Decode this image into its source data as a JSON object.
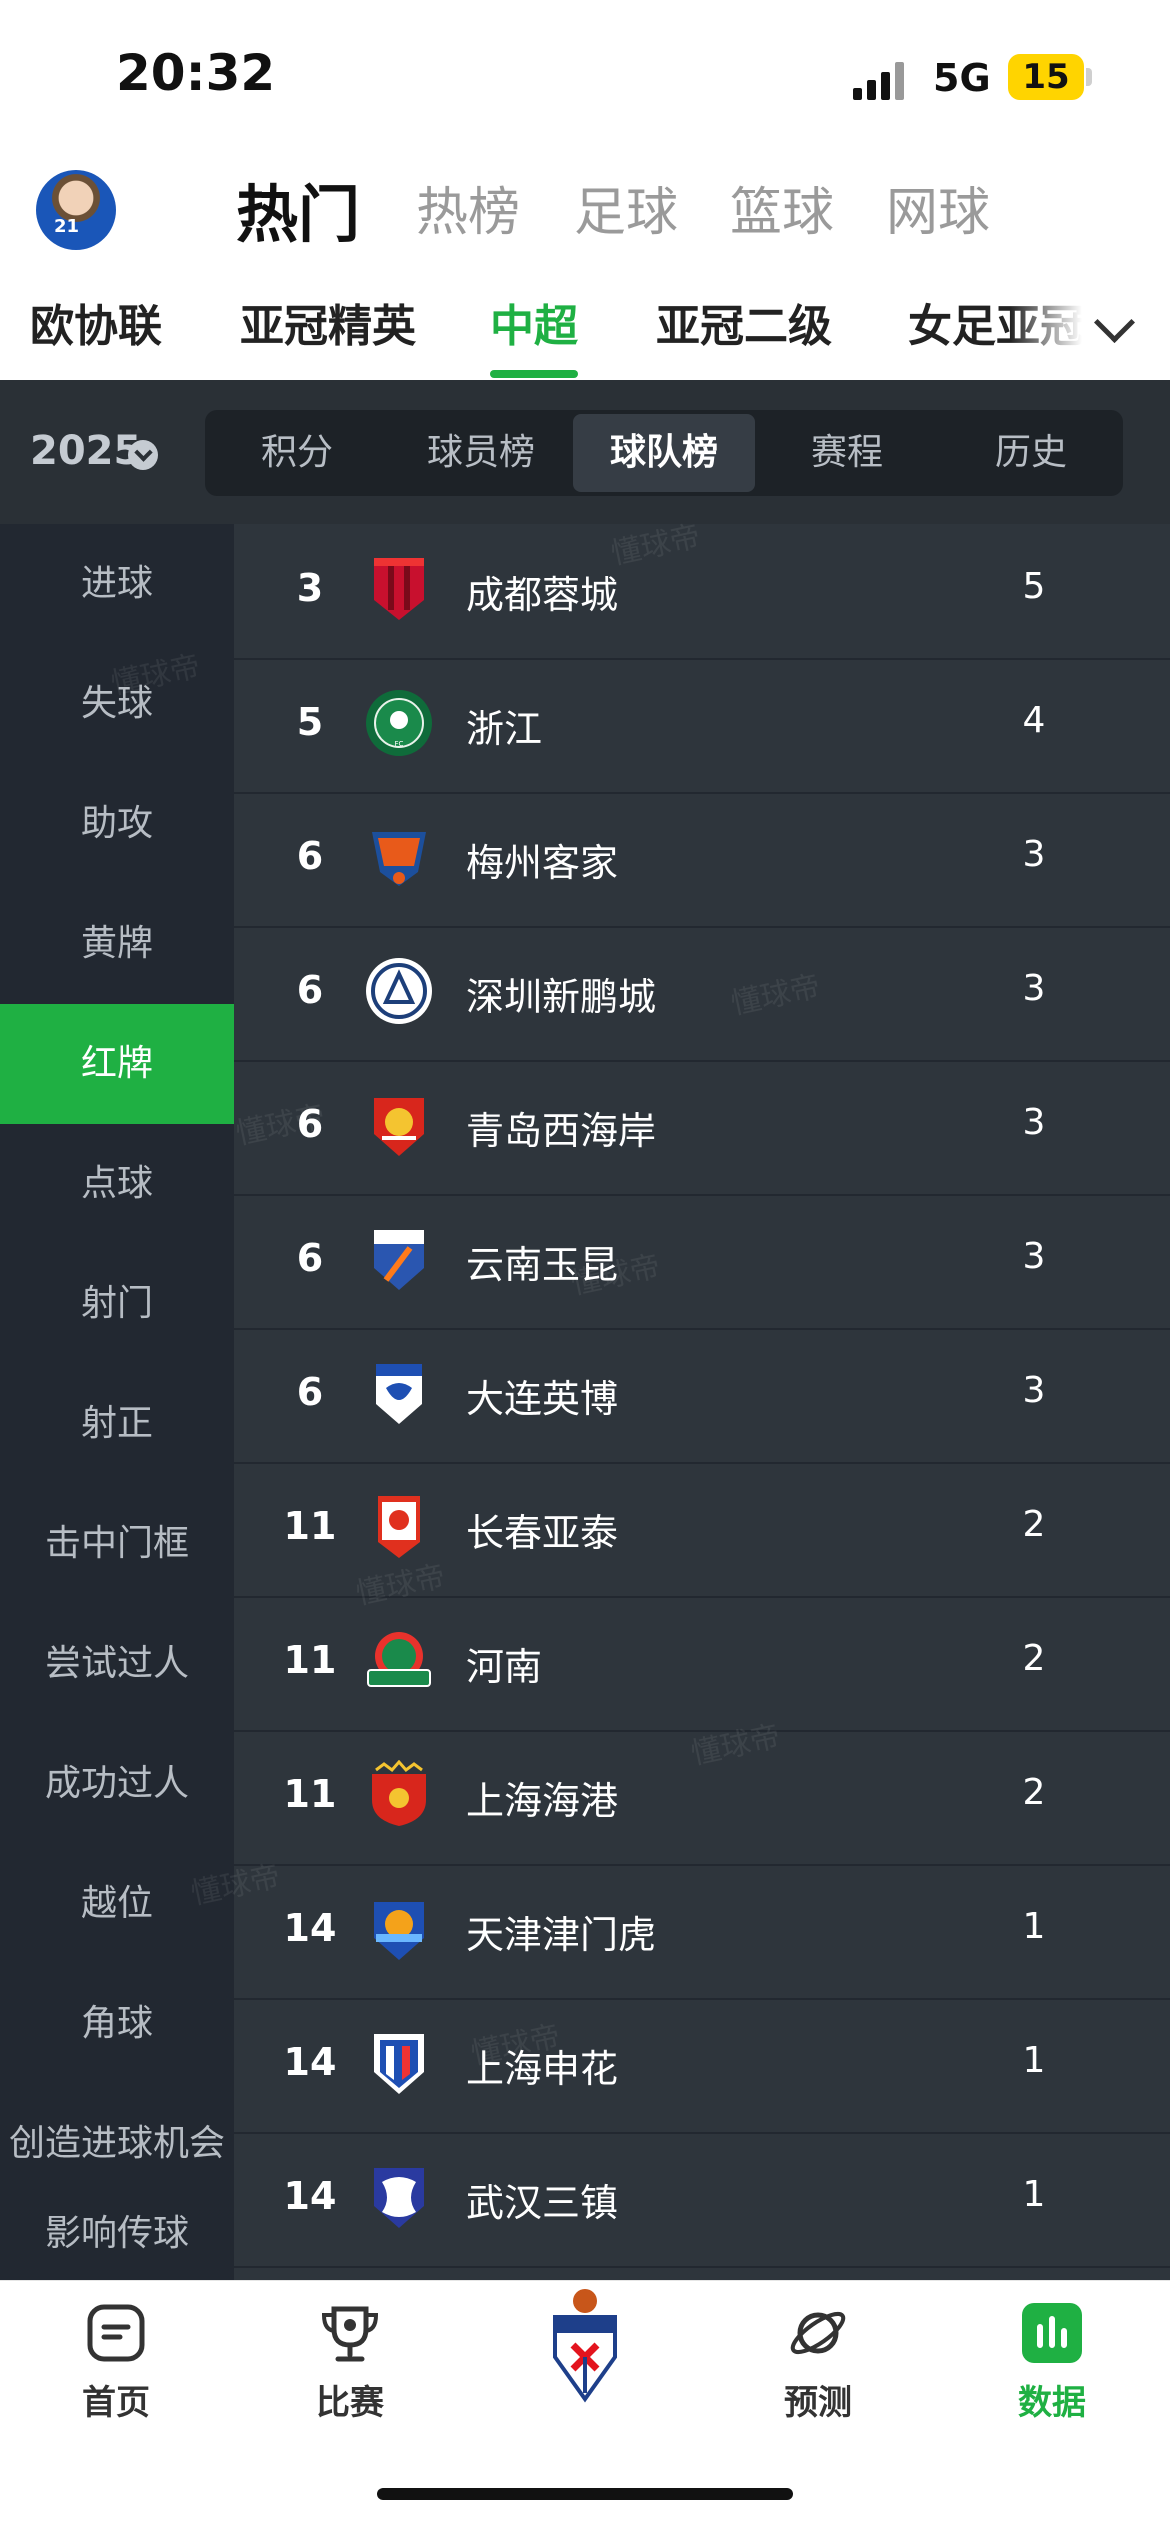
{
  "status_bar": {
    "time": "20:32",
    "network": "5G",
    "battery": "15"
  },
  "header": {
    "avatar_number": "21",
    "main_tabs": [
      {
        "label": "热门",
        "active": true
      },
      {
        "label": "热榜"
      },
      {
        "label": "足球"
      },
      {
        "label": "篮球"
      },
      {
        "label": "网球"
      }
    ],
    "league_tabs": [
      {
        "label": "欧协联"
      },
      {
        "label": "亚冠精英"
      },
      {
        "label": "中超",
        "active": true
      },
      {
        "label": "亚冠二级"
      },
      {
        "label": "女足亚冠"
      }
    ]
  },
  "season": {
    "year": "2025"
  },
  "segments": [
    {
      "label": "积分"
    },
    {
      "label": "球员榜"
    },
    {
      "label": "球队榜",
      "active": true
    },
    {
      "label": "赛程"
    },
    {
      "label": "历史"
    }
  ],
  "sidebar": {
    "items": [
      {
        "label": "进球"
      },
      {
        "label": "失球"
      },
      {
        "label": "助攻"
      },
      {
        "label": "黄牌"
      },
      {
        "label": "红牌",
        "active": true
      },
      {
        "label": "点球"
      },
      {
        "label": "射门"
      },
      {
        "label": "射正"
      },
      {
        "label": "击中门框"
      },
      {
        "label": "尝试过人"
      },
      {
        "label": "成功过人"
      },
      {
        "label": "越位"
      },
      {
        "label": "角球"
      },
      {
        "label": "创造进球机会"
      },
      {
        "label": "影响传球"
      }
    ]
  },
  "table": {
    "rows": [
      {
        "rank": "3",
        "team": "成都蓉城",
        "value": "5",
        "logo": "chengdu-rongcheng-crest"
      },
      {
        "rank": "5",
        "team": "浙江",
        "value": "4",
        "logo": "zhejiang-crest"
      },
      {
        "rank": "6",
        "team": "梅州客家",
        "value": "3",
        "logo": "meizhou-hakka-crest"
      },
      {
        "rank": "6",
        "team": "深圳新鹏城",
        "value": "3",
        "logo": "shenzhen-peng-city-crest"
      },
      {
        "rank": "6",
        "team": "青岛西海岸",
        "value": "3",
        "logo": "qingdao-west-coast-crest"
      },
      {
        "rank": "6",
        "team": "云南玉昆",
        "value": "3",
        "logo": "yunnan-yukun-crest"
      },
      {
        "rank": "6",
        "team": "大连英博",
        "value": "3",
        "logo": "dalian-yingbo-crest"
      },
      {
        "rank": "11",
        "team": "长春亚泰",
        "value": "2",
        "logo": "changchun-yatai-crest"
      },
      {
        "rank": "11",
        "team": "河南",
        "value": "2",
        "logo": "henan-crest"
      },
      {
        "rank": "11",
        "team": "上海海港",
        "value": "2",
        "logo": "shanghai-port-crest"
      },
      {
        "rank": "14",
        "team": "天津津门虎",
        "value": "1",
        "logo": "tianjin-jinmen-tiger-crest"
      },
      {
        "rank": "14",
        "team": "上海申花",
        "value": "1",
        "logo": "shanghai-shenhua-crest"
      },
      {
        "rank": "14",
        "team": "武汉三镇",
        "value": "1",
        "logo": "wuhan-three-towns-crest"
      }
    ]
  },
  "watermark": "懂球帝",
  "bottom_nav": [
    {
      "label": "首页",
      "icon": "home-icon"
    },
    {
      "label": "比赛",
      "icon": "trophy-icon"
    },
    {
      "label": "",
      "icon": "sd-eibar-crest-icon"
    },
    {
      "label": "预测",
      "icon": "planet-icon"
    },
    {
      "label": "数据",
      "icon": "data-chart-icon",
      "active": true
    }
  ],
  "colors": {
    "accent": "#1fb043",
    "dark_bg": "#2a3036",
    "row_bg": "#2e353c",
    "sidebar_bg": "#222831"
  }
}
